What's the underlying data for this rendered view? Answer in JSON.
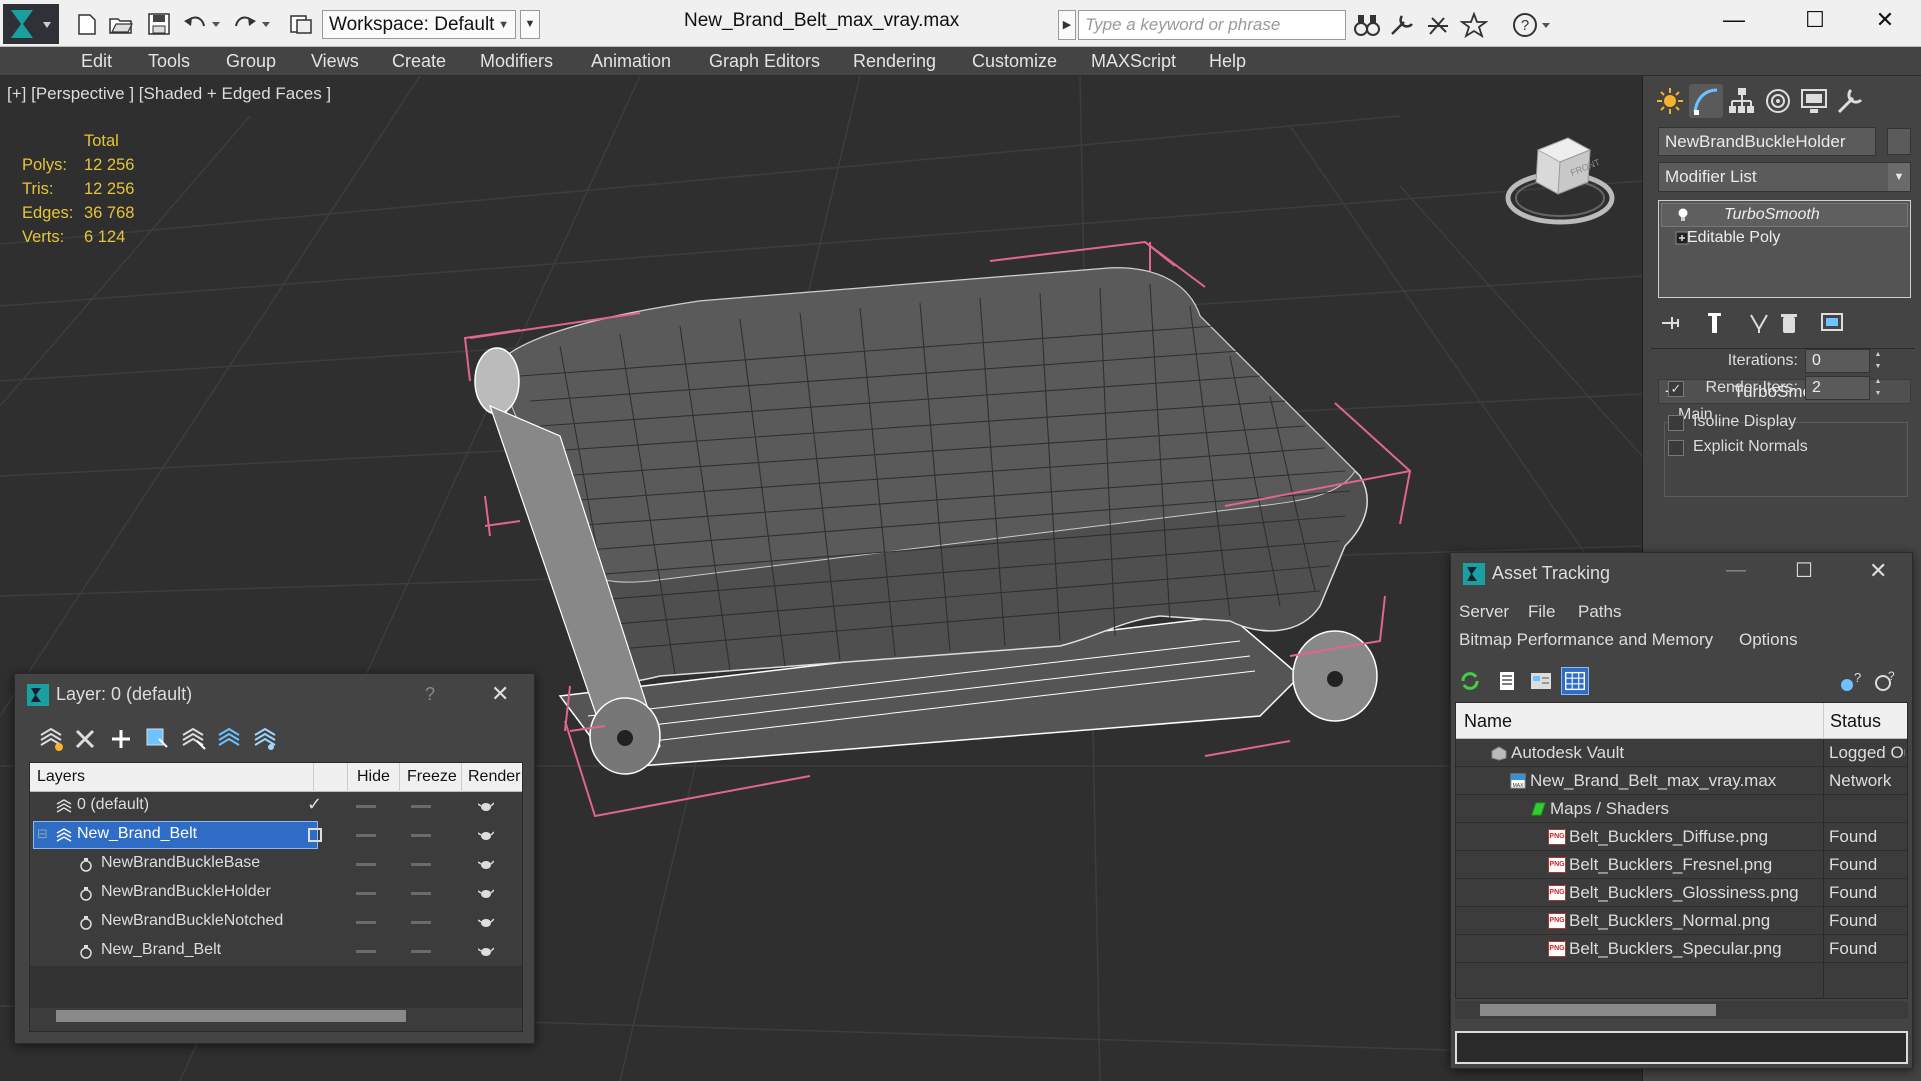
{
  "titlebar": {
    "workspace_label": "Workspace: Default",
    "app_title": "New_Brand_Belt_max_vray.max",
    "search_placeholder": "Type a keyword or phrase"
  },
  "menubar": {
    "items": [
      "Edit",
      "Tools",
      "Group",
      "Views",
      "Create",
      "Modifiers",
      "Animation",
      "Graph Editors",
      "Rendering",
      "Customize",
      "MAXScript",
      "Help"
    ]
  },
  "viewport": {
    "label": "[+] [Perspective ] [Shaded + Edged Faces ]",
    "stats": {
      "header": "Total",
      "rows": [
        {
          "key": "Polys:",
          "value": "12 256"
        },
        {
          "key": "Tris:",
          "value": "12 256"
        },
        {
          "key": "Edges:",
          "value": "36 768"
        },
        {
          "key": "Verts:",
          "value": "6 124"
        }
      ]
    },
    "viewcube_label": "FRONT",
    "colors": {
      "background": "#2f2f2f",
      "grid": "#3c3c3c",
      "selection_brackets": "#e0668c",
      "model_fill": "#585858",
      "wire": "#ffffff"
    }
  },
  "command_panel": {
    "object_name": "NewBrandBuckleHolder",
    "modifier_list_label": "Modifier List",
    "stack": [
      {
        "label": "TurboSmooth",
        "selected": true
      },
      {
        "label": "Editable Poly",
        "selected": false
      }
    ],
    "rollout": {
      "title": "TurboSmooth",
      "group_label": "Main",
      "iterations_label": "Iterations:",
      "iterations_value": "0",
      "render_iters_label": "Render Iters:",
      "render_iters_value": "2",
      "render_iters_checked": true,
      "isoline_label": "Isoline Display",
      "explicit_normals_label": "Explicit Normals"
    }
  },
  "layer_window": {
    "title": "Layer: 0 (default)",
    "help": "?",
    "columns": [
      "Layers",
      "Hide",
      "Freeze",
      "Render"
    ],
    "rows": [
      {
        "name": "0 (default)",
        "kind": "layer",
        "indent": 0
      },
      {
        "name": "New_Brand_Belt",
        "kind": "layer",
        "indent": 0,
        "selected": true
      },
      {
        "name": "NewBrandBuckleBase",
        "kind": "object",
        "indent": 1
      },
      {
        "name": "NewBrandBuckleHolder",
        "kind": "object",
        "indent": 1
      },
      {
        "name": "NewBrandBuckleNotched",
        "kind": "object",
        "indent": 1
      },
      {
        "name": "New_Brand_Belt",
        "kind": "object",
        "indent": 1
      }
    ]
  },
  "asset_window": {
    "title": "Asset Tracking",
    "menu": [
      "Server",
      "File",
      "Paths",
      "Bitmap Performance and Memory",
      "Options"
    ],
    "columns": [
      "Name",
      "Status"
    ],
    "rows": [
      {
        "name": "Autodesk Vault",
        "status": "Logged Out",
        "indent": 0,
        "icon": "vault-icon"
      },
      {
        "name": "New_Brand_Belt_max_vray.max",
        "status": "Network",
        "indent": 1,
        "icon": "max-file-icon"
      },
      {
        "name": "Maps / Shaders",
        "status": "",
        "indent": 2,
        "icon": "maps-folder-icon"
      },
      {
        "name": "Belt_Bucklers_Diffuse.png",
        "status": "Found",
        "indent": 3,
        "icon": "png-file-icon"
      },
      {
        "name": "Belt_Bucklers_Fresnel.png",
        "status": "Found",
        "indent": 3,
        "icon": "png-file-icon"
      },
      {
        "name": "Belt_Bucklers_Glossiness.png",
        "status": "Found",
        "indent": 3,
        "icon": "png-file-icon"
      },
      {
        "name": "Belt_Bucklers_Normal.png",
        "status": "Found",
        "indent": 3,
        "icon": "png-file-icon"
      },
      {
        "name": "Belt_Bucklers_Specular.png",
        "status": "Found",
        "indent": 3,
        "icon": "png-file-icon"
      }
    ]
  }
}
